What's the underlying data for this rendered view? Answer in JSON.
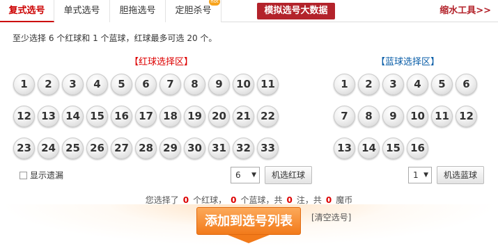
{
  "tabs": [
    {
      "label": "复式选号",
      "active": true
    },
    {
      "label": "单式选号",
      "active": false
    },
    {
      "label": "胆拖选号",
      "active": false
    },
    {
      "label": "定胆杀号",
      "active": false
    }
  ],
  "simulate_button": "模拟选号大数据",
  "tools_link": "缩水工具>>",
  "hint": "至少选择 6 个红球和 1 个蓝球，红球最多可选 20 个。",
  "red_zone": {
    "title": "【红球选择区】",
    "balls": [
      "1",
      "2",
      "3",
      "4",
      "5",
      "6",
      "7",
      "8",
      "9",
      "10",
      "11",
      "12",
      "13",
      "14",
      "15",
      "16",
      "17",
      "18",
      "19",
      "20",
      "21",
      "22",
      "23",
      "24",
      "25",
      "26",
      "27",
      "28",
      "29",
      "30",
      "31",
      "32",
      "33"
    ]
  },
  "blue_zone": {
    "title": "【蓝球选择区】",
    "balls": [
      "1",
      "2",
      "3",
      "4",
      "5",
      "6",
      "7",
      "8",
      "9",
      "10",
      "11",
      "12",
      "13",
      "14",
      "15",
      "16"
    ]
  },
  "show_missing_label": "显示遗漏",
  "red_random": {
    "select_value": "6",
    "button": "机选红球"
  },
  "blue_random": {
    "select_value": "1",
    "button": "机选蓝球"
  },
  "summary": {
    "p1": "您选择了",
    "red_count": "0",
    "p2": "个红球，",
    "blue_count": "0",
    "p3": "个蓝球，共",
    "bets": "0",
    "p4": "注，共",
    "coins": "0",
    "p5": "魔币"
  },
  "add_button": "添加到选号列表",
  "clear_link": "[清空选号]",
  "colors": {
    "accent_red": "#b3232b",
    "blue_title": "#0a5ea8",
    "orange": "#f27a1a"
  }
}
